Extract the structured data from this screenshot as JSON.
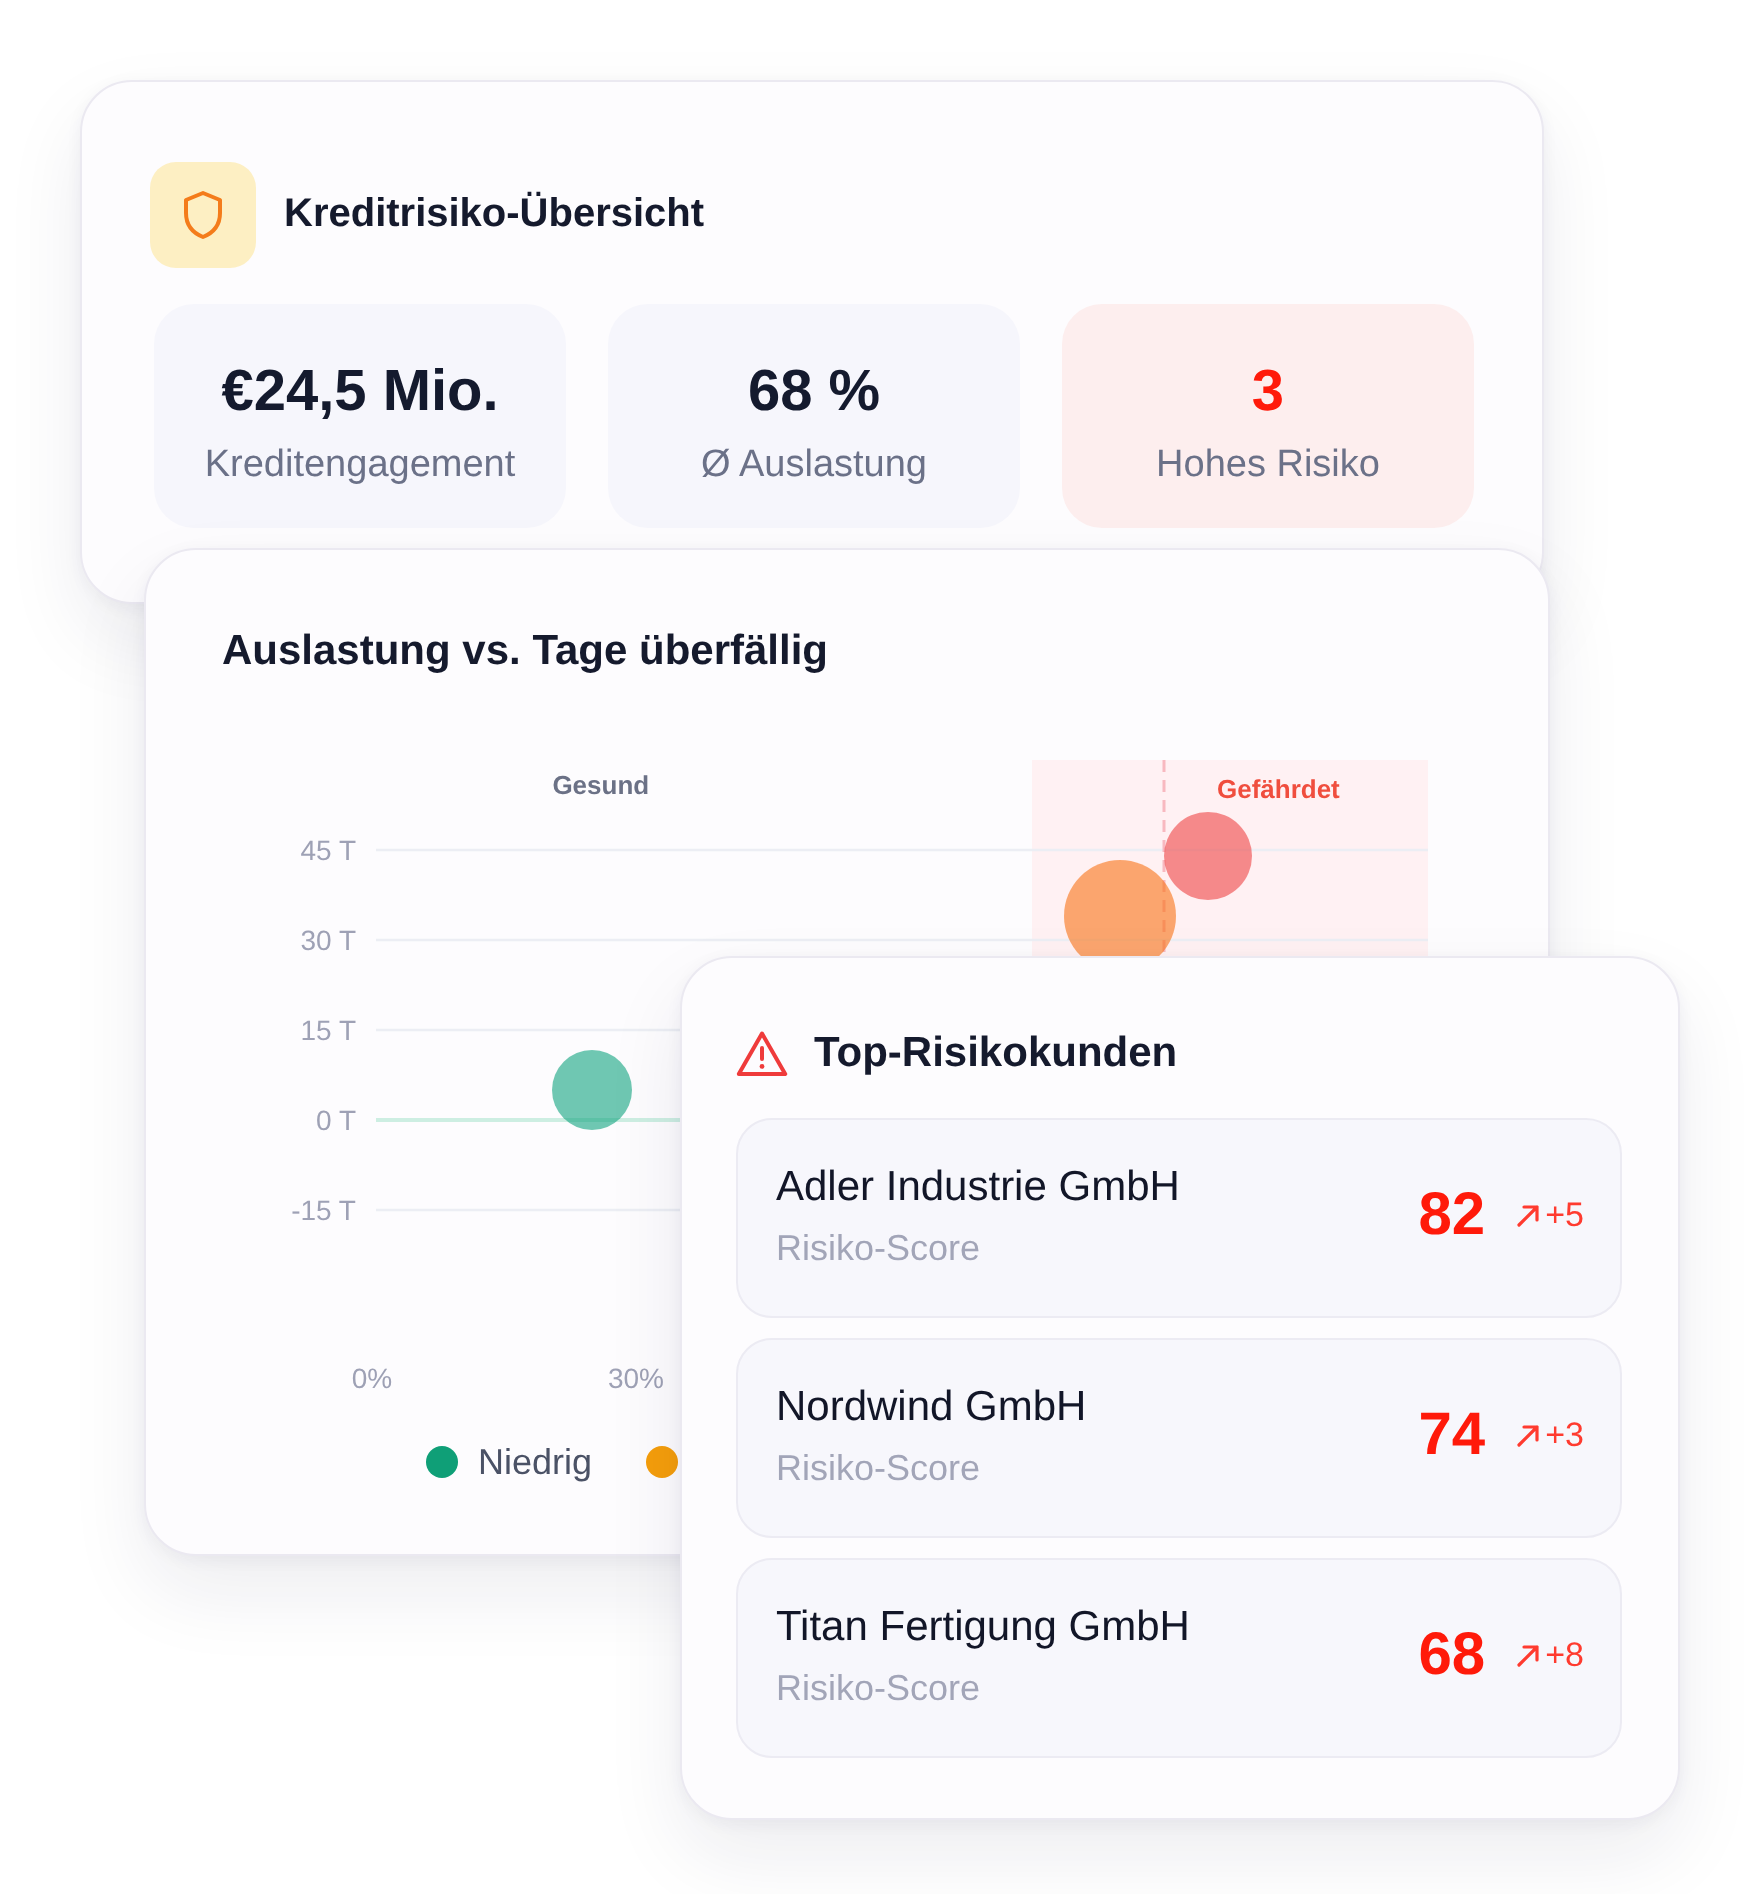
{
  "overview": {
    "title": "Kreditrisiko-Übersicht",
    "stats": [
      {
        "value": "€24,5 Mio.",
        "label": "Kreditengagement",
        "highlight": false
      },
      {
        "value": "68 %",
        "label": "Ø Auslastung",
        "highlight": false
      },
      {
        "value": "3",
        "label": "Hohes Risiko",
        "highlight": true
      }
    ]
  },
  "chart": {
    "title": "Auslastung vs. Tage überfällig",
    "zones": [
      {
        "label": "Gesund",
        "risk": false
      },
      {
        "label": "Gefährdet",
        "risk": true
      }
    ],
    "chart_data": {
      "type": "scatter",
      "x": [
        25,
        85,
        95
      ],
      "series": [
        {
          "color": "#10a37f",
          "values": [
            5,
            null,
            null
          ]
        },
        {
          "color": "#f97316",
          "values": [
            null,
            34,
            null
          ]
        },
        {
          "color": "#ef4444",
          "values": [
            null,
            null,
            44
          ]
        }
      ],
      "xlim": [
        0,
        120
      ],
      "ylim": [
        -30,
        60
      ],
      "grid": true,
      "ref_lines": [
        {
          "axis": "x",
          "value": 90
        }
      ],
      "xticks": [
        {
          "value": 0,
          "label": "0%"
        },
        {
          "value": 30,
          "label": "30%"
        }
      ],
      "yticks": [
        {
          "value": 45,
          "label": "45 T"
        },
        {
          "value": 30,
          "label": "30 T"
        },
        {
          "value": 15,
          "label": "15 T"
        },
        {
          "value": 0,
          "label": "0 T"
        },
        {
          "value": -15,
          "label": "-15 T"
        }
      ]
    },
    "legend": [
      {
        "label": "Niedrig",
        "color": "#0f9f77"
      },
      {
        "color": "#f59e0b"
      }
    ]
  },
  "top_customers": {
    "title": "Top-Risikokunden",
    "rows": [
      {
        "name": "Adler Industrie GmbH",
        "caption": "Risiko-Score",
        "score": "82",
        "change": "+5"
      },
      {
        "name": "Nordwind GmbH",
        "caption": "Risiko-Score",
        "score": "74",
        "change": "+3"
      },
      {
        "name": "Titan Fertigung GmbH",
        "caption": "Risiko-Score",
        "score": "68",
        "change": "+8"
      }
    ]
  }
}
